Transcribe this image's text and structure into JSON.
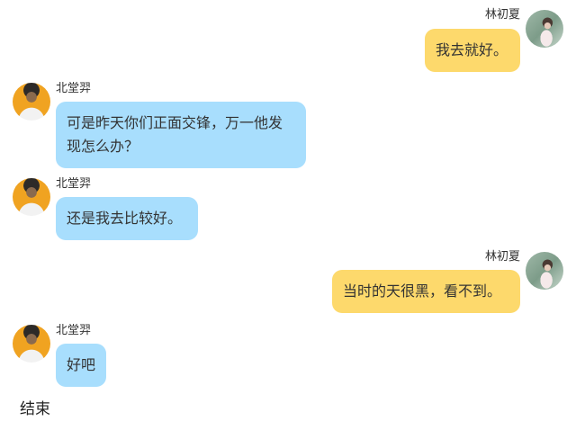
{
  "chat": {
    "messages": [
      {
        "sender": "林初夏",
        "side": "right",
        "text": "我去就好。"
      },
      {
        "sender": "北堂羿",
        "side": "left",
        "text": "可是昨天你们正面交锋，万一他发现怎么办？"
      },
      {
        "sender": "北堂羿",
        "side": "left",
        "text": "还是我去比较好。"
      },
      {
        "sender": "林初夏",
        "side": "right",
        "text": "当时的天很黑，看不到。"
      },
      {
        "sender": "北堂羿",
        "side": "left",
        "text": "好吧"
      }
    ],
    "end_label": "结束"
  },
  "colors": {
    "left_bubble": "#a8defd",
    "right_bubble": "#fdd96c",
    "background": "#ffffff"
  }
}
